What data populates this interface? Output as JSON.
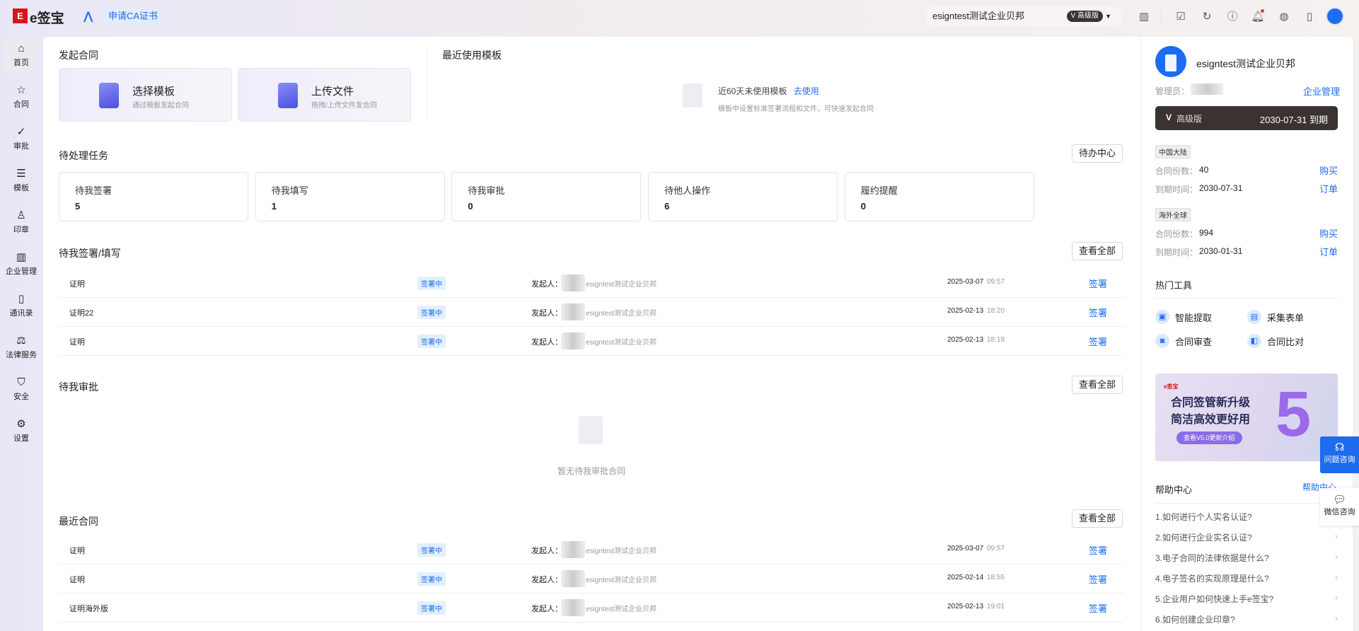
{
  "header": {
    "logo_mark": "E",
    "logo_text": "e签宝",
    "ca_button": "申请CA证书",
    "company": "esigntest测试企业贝邦",
    "plan_badge": "V 高级版",
    "icons": [
      "building-icon",
      "todo-check-icon",
      "history-icon",
      "help-icon",
      "bell-icon",
      "globe-icon",
      "mobile-icon",
      "avatar-icon"
    ]
  },
  "sidebar": {
    "items": [
      {
        "label": "首页",
        "icon": "home-icon",
        "glyph": "⌂"
      },
      {
        "label": "合同",
        "icon": "contract-icon",
        "glyph": "☆"
      },
      {
        "label": "审批",
        "icon": "approval-icon",
        "glyph": "✓"
      },
      {
        "label": "模板",
        "icon": "template-icon",
        "glyph": "☰"
      },
      {
        "label": "印章",
        "icon": "seal-icon",
        "glyph": "♙"
      },
      {
        "label": "企业管理",
        "icon": "enterprise-icon",
        "glyph": "▥"
      },
      {
        "label": "通讯录",
        "icon": "contacts-icon",
        "glyph": "▯"
      },
      {
        "label": "法律服务",
        "icon": "law-icon",
        "glyph": "⚖"
      },
      {
        "label": "安全",
        "icon": "shield-icon",
        "glyph": "⛉"
      },
      {
        "label": "设置",
        "icon": "gear-icon",
        "glyph": "⚙"
      }
    ]
  },
  "start": {
    "title": "发起合同",
    "cards": [
      {
        "title": "选择模板",
        "sub": "通过模板发起合同"
      },
      {
        "title": "上传文件",
        "sub": "拖拽/上传文件发合同"
      }
    ]
  },
  "recent_templates": {
    "title": "最近使用模板",
    "empty_text": "近60天未使用模板",
    "empty_link": "去使用",
    "empty_sub": "模板中设置标准签署流程和文件，可快速发起合同"
  },
  "tasks": {
    "title": "待处理任务",
    "button": "待办中心",
    "items": [
      {
        "label": "待我签署",
        "count": "5"
      },
      {
        "label": "待我填写",
        "count": "1"
      },
      {
        "label": "待我审批",
        "count": "0"
      },
      {
        "label": "待他人操作",
        "count": "6"
      },
      {
        "label": "履约提醒",
        "count": "0"
      }
    ]
  },
  "to_sign": {
    "title": "待我签署/填写",
    "button": "查看全部",
    "rows": [
      {
        "name": "证明",
        "status": "签署中",
        "initiator_label": "发起人：",
        "org": "esigntest测试企业贝邦",
        "date": "2025-03-07",
        "time": "09:57",
        "action": "签署"
      },
      {
        "name": "证明22",
        "status": "签署中",
        "initiator_label": "发起人：",
        "org": "esigntest测试企业贝邦",
        "date": "2025-02-13",
        "time": "18:20",
        "action": "签署"
      },
      {
        "name": "证明",
        "status": "签署中",
        "initiator_label": "发起人：",
        "org": "esigntest测试企业贝邦",
        "date": "2025-02-13",
        "time": "18:19",
        "action": "签署"
      }
    ]
  },
  "to_approve": {
    "title": "待我审批",
    "button": "查看全部",
    "empty_text": "暂无待我审批合同"
  },
  "recent": {
    "title": "最近合同",
    "button": "查看全部",
    "rows": [
      {
        "name": "证明",
        "status": "签署中",
        "initiator_label": "发起人：",
        "org": "esigntest测试企业贝邦",
        "date": "2025-03-07",
        "time": "09:57",
        "action": "签署"
      },
      {
        "name": "证明",
        "status": "签署中",
        "initiator_label": "发起人：",
        "org": "esigntest测试企业贝邦",
        "date": "2025-02-14",
        "time": "18:55",
        "action": "签署"
      },
      {
        "name": "证明海外版",
        "status": "签署中",
        "initiator_label": "发起人：",
        "org": "esigntest测试企业贝邦",
        "date": "2025-02-13",
        "time": "19:01",
        "action": "签署"
      }
    ]
  },
  "account": {
    "company": "esigntest测试企业贝邦",
    "admin_label": "管理员：",
    "manage_link": "企业管理",
    "plan": "高级版",
    "expire": "2030-07-31 到期",
    "regions": [
      {
        "tag": "中国大陆",
        "count_label": "合同份数：",
        "count": "40",
        "buy": "购买",
        "expire_label": "到期时间：",
        "expire": "2030-07-31",
        "order": "订单"
      },
      {
        "tag": "海外全球",
        "count_label": "合同份数：",
        "count": "994",
        "buy": "购买",
        "expire_label": "到期时间：",
        "expire": "2030-01-31",
        "order": "订单"
      }
    ]
  },
  "tools": {
    "title": "热门工具",
    "items": [
      "智能提取",
      "采集表单",
      "合同审查",
      "合同比对"
    ]
  },
  "banner": {
    "brand": "e签宝",
    "line1": "合同签管新升级",
    "line2": "简洁高效更好用",
    "button": "查看V5.0更新介绍",
    "big": "5"
  },
  "help": {
    "title": "帮助中心",
    "link": "帮助中心",
    "items": [
      "1.如何进行个人实名认证?",
      "2.如何进行企业实名认证?",
      "3.电子合同的法律依据是什么?",
      "4.电子签名的实现原理是什么?",
      "5.企业用户如何快速上手e签宝?",
      "6.如何创建企业印章?"
    ]
  },
  "float": {
    "consult": "问题咨询",
    "wechat": "微信咨询"
  },
  "colors": {
    "accent": "#1f6bf0",
    "brand": "#d9141e",
    "plan_bar": "#3b3331"
  }
}
